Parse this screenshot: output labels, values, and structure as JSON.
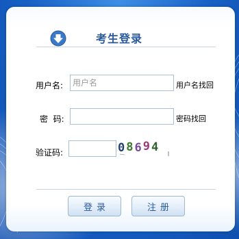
{
  "header": {
    "title": "考生登录",
    "icon": "arrow-down-circle-icon"
  },
  "form": {
    "username": {
      "label": "用户名:",
      "placeholder": "用户名",
      "value": "",
      "link": "用户名找回"
    },
    "password": {
      "label": "密  码:",
      "value": "",
      "link": "密码找回"
    },
    "captcha": {
      "label": "验证码:",
      "value": "",
      "image_text": "08694"
    }
  },
  "buttons": {
    "login": "登录",
    "register": "注册"
  },
  "colors": {
    "background": "#1a66c9",
    "title": "#2a5a9c",
    "icon": "#3b78c8"
  }
}
